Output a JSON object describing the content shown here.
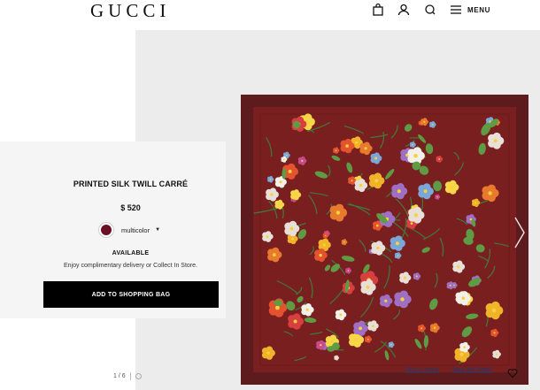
{
  "header": {
    "logo": "GUCCI",
    "menu_label": "MENU",
    "icons": [
      "shopping-bag-icon",
      "user-icon",
      "search-icon",
      "hamburger-icon"
    ]
  },
  "product": {
    "name": "PRINTED SILK TWILL CARRÉ",
    "price": "$ 520",
    "color_selected": "multicolor",
    "swatch_color": "#6d0f24",
    "availability": "AVAILABLE",
    "delivery_text": "Enjoy complimentary delivery or Collect In Store.",
    "cta_label": "ADD TO SHOPPING BAG"
  },
  "gallery": {
    "counter": "1 / 6",
    "find_in_store": "Find in store",
    "may_we_help": "May We Help?",
    "scarf_border_color": "#5e1b1e",
    "scarf_center_color": "#7a1f20"
  }
}
